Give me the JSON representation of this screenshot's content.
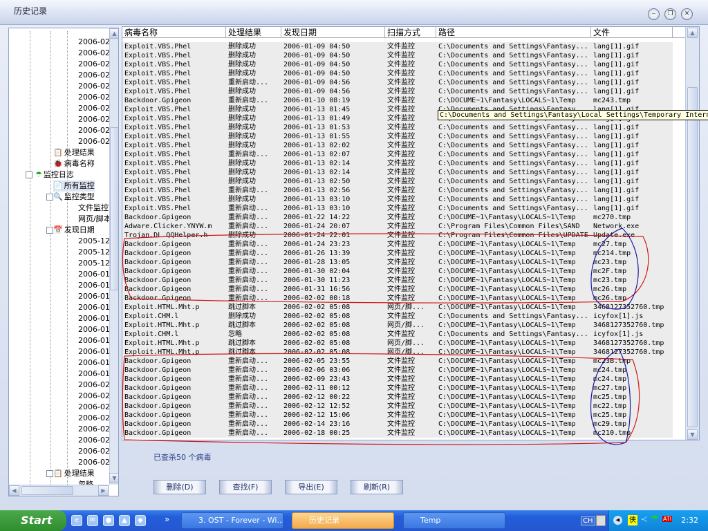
{
  "window": {
    "title": "历史记录",
    "minimize": "‒",
    "restore": "❐",
    "close": "✕"
  },
  "tree": {
    "nodes": [
      {
        "label": "2006-02",
        "level": 3
      },
      {
        "label": "2006-02",
        "level": 3
      },
      {
        "label": "2006-02",
        "level": 3
      },
      {
        "label": "2006-02",
        "level": 3
      },
      {
        "label": "2006-02",
        "level": 3
      },
      {
        "label": "2006-02",
        "level": 3
      },
      {
        "label": "2006-02",
        "level": 3
      },
      {
        "label": "2006-02",
        "level": 3
      },
      {
        "label": "2006-02",
        "level": 3
      },
      {
        "label": "2006-02",
        "level": 3
      },
      {
        "label": "处理结果",
        "level": 2,
        "icon": "result"
      },
      {
        "label": "病毒名称",
        "level": 2,
        "icon": "virus"
      },
      {
        "label": "监控日志",
        "level": 1,
        "icon": "umbrella",
        "expand": "−"
      },
      {
        "label": "所有监控",
        "level": 2,
        "icon": "doc",
        "selected": true
      },
      {
        "label": "监控类型",
        "level": 2,
        "icon": "search",
        "expand": "−"
      },
      {
        "label": "文件监控",
        "level": 3
      },
      {
        "label": "网页/脚本监控",
        "level": 3
      },
      {
        "label": "发现日期",
        "level": 2,
        "icon": "calendar",
        "expand": "−"
      },
      {
        "label": "2005-12",
        "level": 3
      },
      {
        "label": "2005-12",
        "level": 3
      },
      {
        "label": "2005-12",
        "level": 3
      },
      {
        "label": "2006-01",
        "level": 3
      },
      {
        "label": "2006-01",
        "level": 3
      },
      {
        "label": "2006-01",
        "level": 3
      },
      {
        "label": "2006-01",
        "level": 3
      },
      {
        "label": "2006-01",
        "level": 3
      },
      {
        "label": "2006-01",
        "level": 3
      },
      {
        "label": "2006-01",
        "level": 3
      },
      {
        "label": "2006-01",
        "level": 3
      },
      {
        "label": "2006-01",
        "level": 3
      },
      {
        "label": "2006-01",
        "level": 3
      },
      {
        "label": "2006-02",
        "level": 3
      },
      {
        "label": "2006-02",
        "level": 3
      },
      {
        "label": "2006-02",
        "level": 3
      },
      {
        "label": "2006-02",
        "level": 3
      },
      {
        "label": "2006-02",
        "level": 3
      },
      {
        "label": "2006-02",
        "level": 3
      },
      {
        "label": "2006-02",
        "level": 3
      },
      {
        "label": "2006-02",
        "level": 3
      },
      {
        "label": "处理结果",
        "level": 2,
        "icon": "result",
        "expand": "−"
      },
      {
        "label": "忽略",
        "level": 3
      }
    ]
  },
  "table": {
    "columns": [
      "病毒名称",
      "处理结果",
      "发现日期",
      "扫描方式",
      "路径",
      "文件"
    ],
    "rows": [
      [
        "Exploit.VBS.Phel",
        "删除成功",
        "2006-01-09 04:50",
        "文件监控",
        "C:\\Documents and Settings\\Fantasy...",
        "lang[1].gif"
      ],
      [
        "Exploit.VBS.Phel",
        "删除成功",
        "2006-01-09 04:50",
        "文件监控",
        "C:\\Documents and Settings\\Fantasy...",
        "lang[1].gif"
      ],
      [
        "Exploit.VBS.Phel",
        "删除成功",
        "2006-01-09 04:50",
        "文件监控",
        "C:\\Documents and Settings\\Fantasy...",
        "lang[1].gif"
      ],
      [
        "Exploit.VBS.Phel",
        "删除成功",
        "2006-01-09 04:50",
        "文件监控",
        "C:\\Documents and Settings\\Fantasy...",
        "lang[1].gif"
      ],
      [
        "Exploit.VBS.Phel",
        "重新启动...",
        "2006-01-09 04:56",
        "文件监控",
        "C:\\Documents and Settings\\Fantasy...",
        "lang[1].gif"
      ],
      [
        "Exploit.VBS.Phel",
        "删除成功",
        "2006-01-09 04:56",
        "文件监控",
        "C:\\Documents and Settings\\Fantasy...",
        "lang[1].gif"
      ],
      [
        "Backdoor.Gpigeon",
        "重新启动...",
        "2006-01-10 08:19",
        "文件监控",
        "C:\\DOCUME~1\\Fantasy\\LOCALS~1\\Temp",
        "mc243.tmp"
      ],
      [
        "Exploit.VBS.Phel",
        "删除成功",
        "2006-01-13 01:45",
        "文件监控",
        "C:\\Documents and Settings\\Fantasy...",
        "lang[1].gif"
      ],
      [
        "Exploit.VBS.Phel",
        "删除成功",
        "2006-01-13 01:49",
        "文件监控",
        "C:\\Documents and Settings\\Fantasy...",
        "lang[1].gif"
      ],
      [
        "Exploit.VBS.Phel",
        "删除成功",
        "2006-01-13 01:53",
        "文件监控",
        "C:\\Documents and Settings\\Fantasy...",
        "lang[1].gif"
      ],
      [
        "Exploit.VBS.Phel",
        "删除成功",
        "2006-01-13 01:55",
        "文件监控",
        "C:\\Documents and Settings\\Fantasy...",
        "lang[1].gif"
      ],
      [
        "Exploit.VBS.Phel",
        "删除成功",
        "2006-01-13 02:02",
        "文件监控",
        "C:\\Documents and Settings\\Fantasy...",
        "lang[1].gif"
      ],
      [
        "Exploit.VBS.Phel",
        "重新启动...",
        "2006-01-13 02:07",
        "文件监控",
        "C:\\Documents and Settings\\Fantasy...",
        "lang[1].gif"
      ],
      [
        "Exploit.VBS.Phel",
        "删除成功",
        "2006-01-13 02:14",
        "文件监控",
        "C:\\Documents and Settings\\Fantasy...",
        "lang[1].gif"
      ],
      [
        "Exploit.VBS.Phel",
        "删除成功",
        "2006-01-13 02:14",
        "文件监控",
        "C:\\Documents and Settings\\Fantasy...",
        "lang[1].gif"
      ],
      [
        "Exploit.VBS.Phel",
        "删除成功",
        "2006-01-13 02:50",
        "文件监控",
        "C:\\Documents and Settings\\Fantasy...",
        "lang[1].gif"
      ],
      [
        "Exploit.VBS.Phel",
        "重新启动...",
        "2006-01-13 02:56",
        "文件监控",
        "C:\\Documents and Settings\\Fantasy...",
        "lang[1].gif"
      ],
      [
        "Exploit.VBS.Phel",
        "删除成功",
        "2006-01-13 03:10",
        "文件监控",
        "C:\\Documents and Settings\\Fantasy...",
        "lang[1].gif"
      ],
      [
        "Exploit.VBS.Phel",
        "重新启动...",
        "2006-01-13 03:10",
        "文件监控",
        "C:\\Documents and Settings\\Fantasy...",
        "lang[1].gif"
      ],
      [
        "Backdoor.Gpigeon",
        "重新启动...",
        "2006-01-22 14:22",
        "文件监控",
        "C:\\DOCUME~1\\Fantasy\\LOCALS~1\\Temp",
        "mc270.tmp"
      ],
      [
        "Adware.Clicker.YNYW.m",
        "重新启动...",
        "2006-01-24 20:07",
        "文件监控",
        "C:\\Program Files\\Common Files\\SAND",
        "Network.exe"
      ],
      [
        "Trojan.DL.QQHelper.h",
        "删除成功",
        "2006-01-24 22:01",
        "文件监控",
        "C:\\Program Files\\Common Files\\UPDATE",
        "Update.exe"
      ],
      [
        "Backdoor.Gpigeon",
        "重新启动...",
        "2006-01-24 23:23",
        "文件监控",
        "C:\\DOCUME~1\\Fantasy\\LOCALS~1\\Temp",
        "mc27.tmp"
      ],
      [
        "Backdoor.Gpigeon",
        "重新启动...",
        "2006-01-26 13:39",
        "文件监控",
        "C:\\DOCUME~1\\Fantasy\\LOCALS~1\\Temp",
        "mc214.tmp"
      ],
      [
        "Backdoor.Gpigeon",
        "重新启动...",
        "2006-01-28 13:05",
        "文件监控",
        "C:\\DOCUME~1\\Fantasy\\LOCALS~1\\Temp",
        "mc23.tmp"
      ],
      [
        "Backdoor.Gpigeon",
        "重新启动...",
        "2006-01-30 02:04",
        "文件监控",
        "C:\\DOCUME~1\\Fantasy\\LOCALS~1\\Temp",
        "mc2F.tmp"
      ],
      [
        "Backdoor.Gpigeon",
        "重新启动...",
        "2006-01-30 11:23",
        "文件监控",
        "C:\\DOCUME~1\\Fantasy\\LOCALS~1\\Temp",
        "mc23.tmp"
      ],
      [
        "Backdoor.Gpigeon",
        "重新启动...",
        "2006-01-31 16:56",
        "文件监控",
        "C:\\DOCUME~1\\Fantasy\\LOCALS~1\\Temp",
        "mc26.tmp"
      ],
      [
        "Backdoor.Gpigeon",
        "重新启动...",
        "2006-02-02 00:18",
        "文件监控",
        "C:\\DOCUME~1\\Fantasy\\LOCALS~1\\Temp",
        "mc26.tmp"
      ],
      [
        "Exploit.HTML.Mht.p",
        "跳过脚本",
        "2006-02-02 05:08",
        "网页/脚...",
        "C:\\DOCUME~1\\Fantasy\\LOCALS~1\\Temp",
        "3468127352760.tmp"
      ],
      [
        "Exploit.CHM.l",
        "删除成功",
        "2006-02-02 05:08",
        "文件监控",
        "C:\\Documents and Settings\\Fantasy...",
        "icyfox[1].js"
      ],
      [
        "Exploit.HTML.Mht.p",
        "跳过脚本",
        "2006-02-02 05:08",
        "网页/脚...",
        "C:\\DOCUME~1\\Fantasy\\LOCALS~1\\Temp",
        "3468127352760.tmp"
      ],
      [
        "Exploit.CHM.l",
        "忽略",
        "2006-02-02 05:08",
        "文件监控",
        "C:\\Documents and Settings\\Fantasy...",
        "icyfox[1].js"
      ],
      [
        "Exploit.HTML.Mht.p",
        "跳过脚本",
        "2006-02-02 05:08",
        "网页/脚...",
        "C:\\DOCUME~1\\Fantasy\\LOCALS~1\\Temp",
        "3468127352760.tmp"
      ],
      [
        "Exploit.HTML.Mht.p",
        "跳过脚本",
        "2006-02-02 05:08",
        "网页/脚...",
        "C:\\DOCUME~1\\Fantasy\\LOCALS~1\\Temp",
        "3468127352760.tmp"
      ],
      [
        "Backdoor.Gpigeon",
        "重新启动...",
        "2006-02-05 23:55",
        "文件监控",
        "C:\\DOCUME~1\\Fantasy\\LOCALS~1\\Temp",
        "mc23B.tmp"
      ],
      [
        "Backdoor.Gpigeon",
        "重新启动...",
        "2006-02-06 03:06",
        "文件监控",
        "C:\\DOCUME~1\\Fantasy\\LOCALS~1\\Temp",
        "mc24.tmp"
      ],
      [
        "Backdoor.Gpigeon",
        "重新启动...",
        "2006-02-09 23:43",
        "文件监控",
        "C:\\DOCUME~1\\Fantasy\\LOCALS~1\\Temp",
        "mc24.tmp"
      ],
      [
        "Backdoor.Gpigeon",
        "重新启动...",
        "2006-02-11 00:12",
        "文件监控",
        "C:\\DOCUME~1\\Fantasy\\LOCALS~1\\Temp",
        "mc27.tmp"
      ],
      [
        "Backdoor.Gpigeon",
        "重新启动...",
        "2006-02-12 00:22",
        "文件监控",
        "C:\\DOCUME~1\\Fantasy\\LOCALS~1\\Temp",
        "mc25.tmp"
      ],
      [
        "Backdoor.Gpigeon",
        "重新启动...",
        "2006-02-12 12:52",
        "文件监控",
        "C:\\DOCUME~1\\Fantasy\\LOCALS~1\\Temp",
        "mc22.tmp"
      ],
      [
        "Backdoor.Gpigeon",
        "重新启动...",
        "2006-02-12 15:06",
        "文件监控",
        "C:\\DOCUME~1\\Fantasy\\LOCALS~1\\Temp",
        "mc25.tmp"
      ],
      [
        "Backdoor.Gpigeon",
        "重新启动...",
        "2006-02-14 23:16",
        "文件监控",
        "C:\\DOCUME~1\\Fantasy\\LOCALS~1\\Temp",
        "mc29.tmp"
      ],
      [
        "Backdoor.Gpigeon",
        "重新启动...",
        "2006-02-18 00:25",
        "文件监控",
        "C:\\DOCUME~1\\Fantasy\\LOCALS~1\\Temp",
        "mc210.tmp"
      ]
    ],
    "tooltip": "C:\\Documents and Settings\\Fantasy\\Local Settings\\Temporary Internet Files"
  },
  "status": "已查杀50 个病毒",
  "buttons": {
    "delete": "删除(D)",
    "find": "查找(F)",
    "export": "导出(E)",
    "refresh": "刷新(R)"
  },
  "taskbar": {
    "start": "Start",
    "more": "»",
    "tasks": [
      "3. OST - Forever - Wi...",
      "历史记录",
      "Temp"
    ],
    "ime": "CH",
    "clock": "2:32"
  },
  "colors": {
    "annotation_red": "#d01818",
    "annotation_blue": "#1a1aa0"
  }
}
